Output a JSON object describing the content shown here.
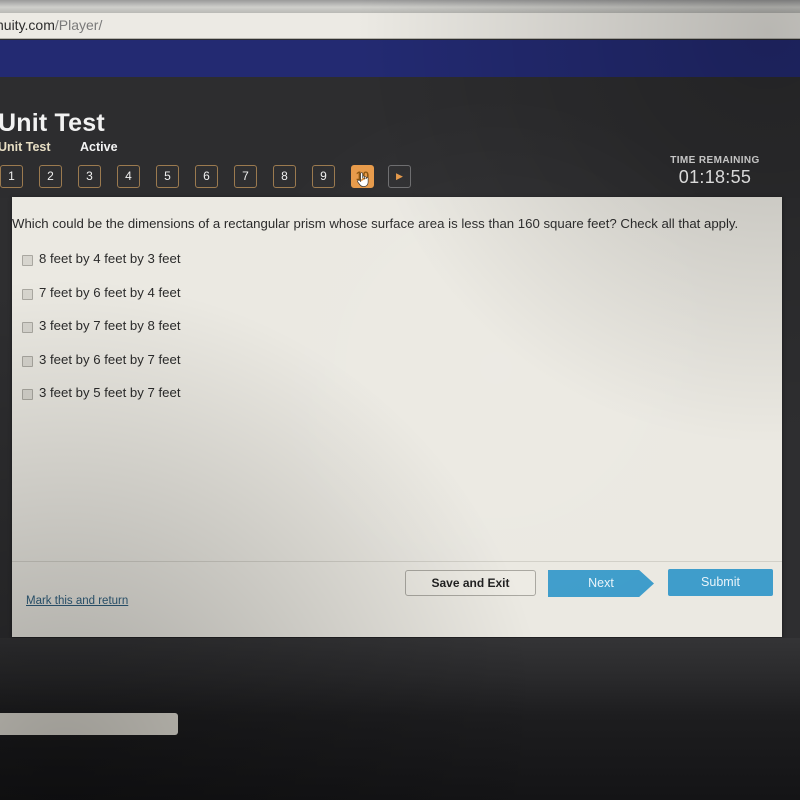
{
  "browser": {
    "url_visible": "nuity.com",
    "url_path": "/Player/"
  },
  "header": {
    "title": "Unit Test",
    "tabs": [
      {
        "label": "Unit Test",
        "state": "active"
      },
      {
        "label": "Active",
        "state": "plain"
      }
    ],
    "timer": {
      "label": "TIME REMAINING",
      "value": "01:18:55"
    }
  },
  "pager": {
    "buttons": [
      {
        "label": "1",
        "current": false
      },
      {
        "label": "2",
        "current": false
      },
      {
        "label": "3",
        "current": false
      },
      {
        "label": "4",
        "current": false
      },
      {
        "label": "5",
        "current": false
      },
      {
        "label": "6",
        "current": false
      },
      {
        "label": "7",
        "current": false
      },
      {
        "label": "8",
        "current": false
      },
      {
        "label": "9",
        "current": false
      },
      {
        "label": "10",
        "current": true
      }
    ],
    "next_arrow": "▶"
  },
  "question": {
    "prompt": "Which could be the dimensions of a rectangular prism whose surface area is less than 160 square feet? Check all that apply.",
    "options": [
      {
        "label": "8 feet by 4 feet by 3 feet",
        "checked": false
      },
      {
        "label": "7 feet by 6 feet by 4 feet",
        "checked": false
      },
      {
        "label": "3 feet by 7 feet by 8 feet",
        "checked": false
      },
      {
        "label": "3 feet by 6 feet by 7 feet",
        "checked": false
      },
      {
        "label": "3 feet by 5 feet by 7 feet",
        "checked": false
      }
    ]
  },
  "actions": {
    "save_and_exit": "Save and Exit",
    "next": "Next",
    "submit": "Submit",
    "mark_and_return": "Mark this and return"
  },
  "colors": {
    "navy_banner": "#232a72",
    "dark_header": "#2d2d2f",
    "panel_background": "#ebe9e2",
    "accent_blue": "#3f9dcb",
    "accent_orange": "#e79a4a",
    "tab_active_text": "#e8dfc4",
    "link_blue": "#2f5f7e"
  }
}
